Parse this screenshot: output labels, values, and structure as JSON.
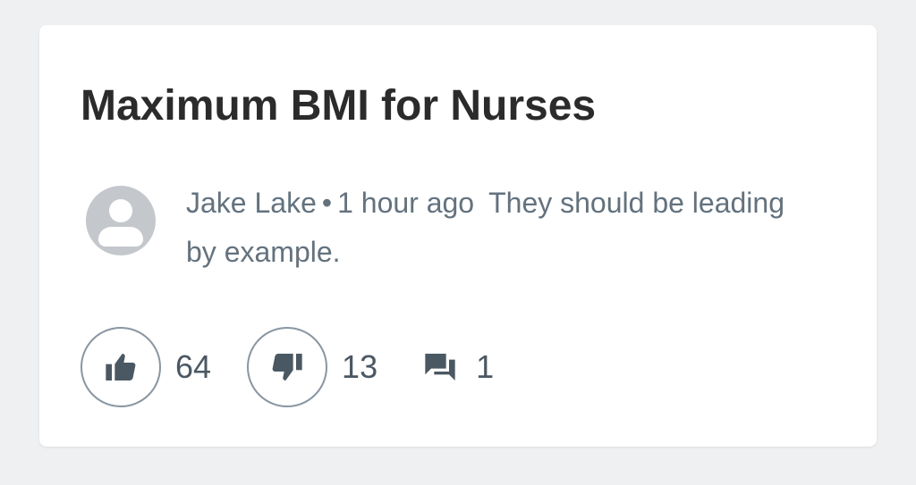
{
  "post": {
    "title": "Maximum BMI for Nurses"
  },
  "comment": {
    "author": "Jake Lake",
    "separator": "•",
    "time": "1 hour ago",
    "text": "They should be leading by example."
  },
  "actions": {
    "likes": "64",
    "dislikes": "13",
    "replies": "1"
  },
  "icons": {
    "like": "thumbs-up-icon",
    "dislike": "thumbs-down-icon",
    "replies": "comments-icon",
    "avatar": "user-avatar-icon"
  },
  "colors": {
    "background": "#eef0f2",
    "card": "#ffffff",
    "title": "#2b2b2b",
    "muted_text": "#62727f",
    "icon": "#4a5864",
    "avatar": "#c4c8cc"
  }
}
